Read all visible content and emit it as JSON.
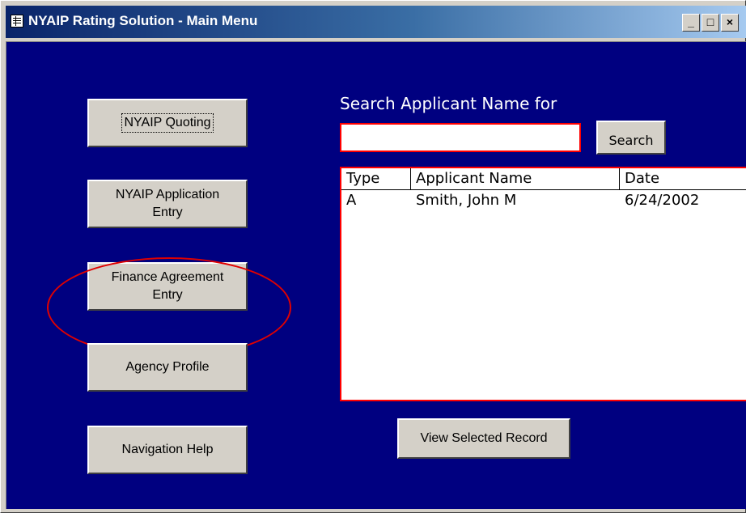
{
  "window": {
    "title": "NYAIP Rating Solution - Main Menu",
    "controls": {
      "minimize": "_",
      "restore": "□",
      "close": "×"
    }
  },
  "nav_buttons": [
    {
      "label": "NYAIP Quoting",
      "focused": true,
      "lines": [
        "NYAIP Quoting"
      ]
    },
    {
      "label": "NYAIP Application Entry",
      "lines": [
        "NYAIP Application",
        "Entry"
      ]
    },
    {
      "label": "Finance Agreement Entry",
      "lines": [
        "Finance Agreement",
        "Entry"
      ],
      "highlighted": true
    },
    {
      "label": "Agency Profile",
      "lines": [
        "Agency Profile"
      ]
    },
    {
      "label": "Navigation Help",
      "lines": [
        "Navigation Help"
      ]
    }
  ],
  "search": {
    "label": "Search Applicant Name for",
    "value": "",
    "button_label": "Search"
  },
  "results": {
    "columns": [
      "Type",
      "Applicant Name",
      "Date"
    ],
    "rows": [
      {
        "type": "A",
        "name": "Smith, John M",
        "date": "6/24/2002"
      }
    ]
  },
  "view_button_label": "View Selected Record",
  "colors": {
    "background": "#000080",
    "highlight": "#e00000",
    "field_border": "#ff0000"
  }
}
